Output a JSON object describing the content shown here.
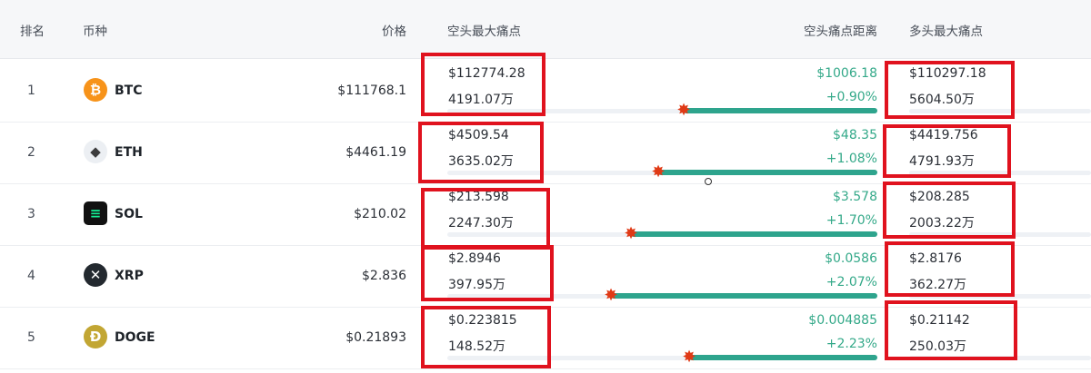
{
  "header": {
    "rank": "排名",
    "coin": "币种",
    "price": "价格",
    "short_max_pain": "空头最大痛点",
    "short_pain_distance": "空头痛点距离",
    "long_max_pain": "多头最大痛点"
  },
  "rows": [
    {
      "rank": "1",
      "coin": "BTC",
      "icon": "bitcoin-icon",
      "icon_color": "#f7931a",
      "price": "$111768.1",
      "short_pain_price": "$112774.28",
      "short_pain_amount": "4191.07万",
      "distance_amount": "$1006.18",
      "distance_pct": "+0.90%",
      "long_pain_price": "$110297.18",
      "long_pain_amount": "5604.50万"
    },
    {
      "rank": "2",
      "coin": "ETH",
      "icon": "ethereum-icon",
      "icon_color": "#3c3c3d",
      "price": "$4461.19",
      "short_pain_price": "$4509.54",
      "short_pain_amount": "3635.02万",
      "distance_amount": "$48.35",
      "distance_pct": "+1.08%",
      "long_pain_price": "$4419.756",
      "long_pain_amount": "4791.93万"
    },
    {
      "rank": "3",
      "coin": "SOL",
      "icon": "solana-icon",
      "icon_color": "#14f195",
      "price": "$210.02",
      "short_pain_price": "$213.598",
      "short_pain_amount": "2247.30万",
      "distance_amount": "$3.578",
      "distance_pct": "+1.70%",
      "long_pain_price": "$208.285",
      "long_pain_amount": "2003.22万"
    },
    {
      "rank": "4",
      "coin": "XRP",
      "icon": "xrp-icon",
      "icon_color": "#23292f",
      "price": "$2.836",
      "short_pain_price": "$2.8946",
      "short_pain_amount": "397.95万",
      "distance_amount": "$0.0586",
      "distance_pct": "+2.07%",
      "long_pain_price": "$2.8176",
      "long_pain_amount": "362.27万"
    },
    {
      "rank": "5",
      "coin": "DOGE",
      "icon": "dogecoin-icon",
      "icon_color": "#c2a633",
      "price": "$0.21893",
      "short_pain_price": "$0.223815",
      "short_pain_amount": "148.52万",
      "distance_amount": "$0.004885",
      "distance_pct": "+2.23%",
      "long_pain_price": "$0.21142",
      "long_pain_amount": "250.03万"
    }
  ],
  "colors": {
    "positive": "#34a989",
    "bar_fill": "#2ea48d",
    "highlight_box": "#e0121e"
  }
}
